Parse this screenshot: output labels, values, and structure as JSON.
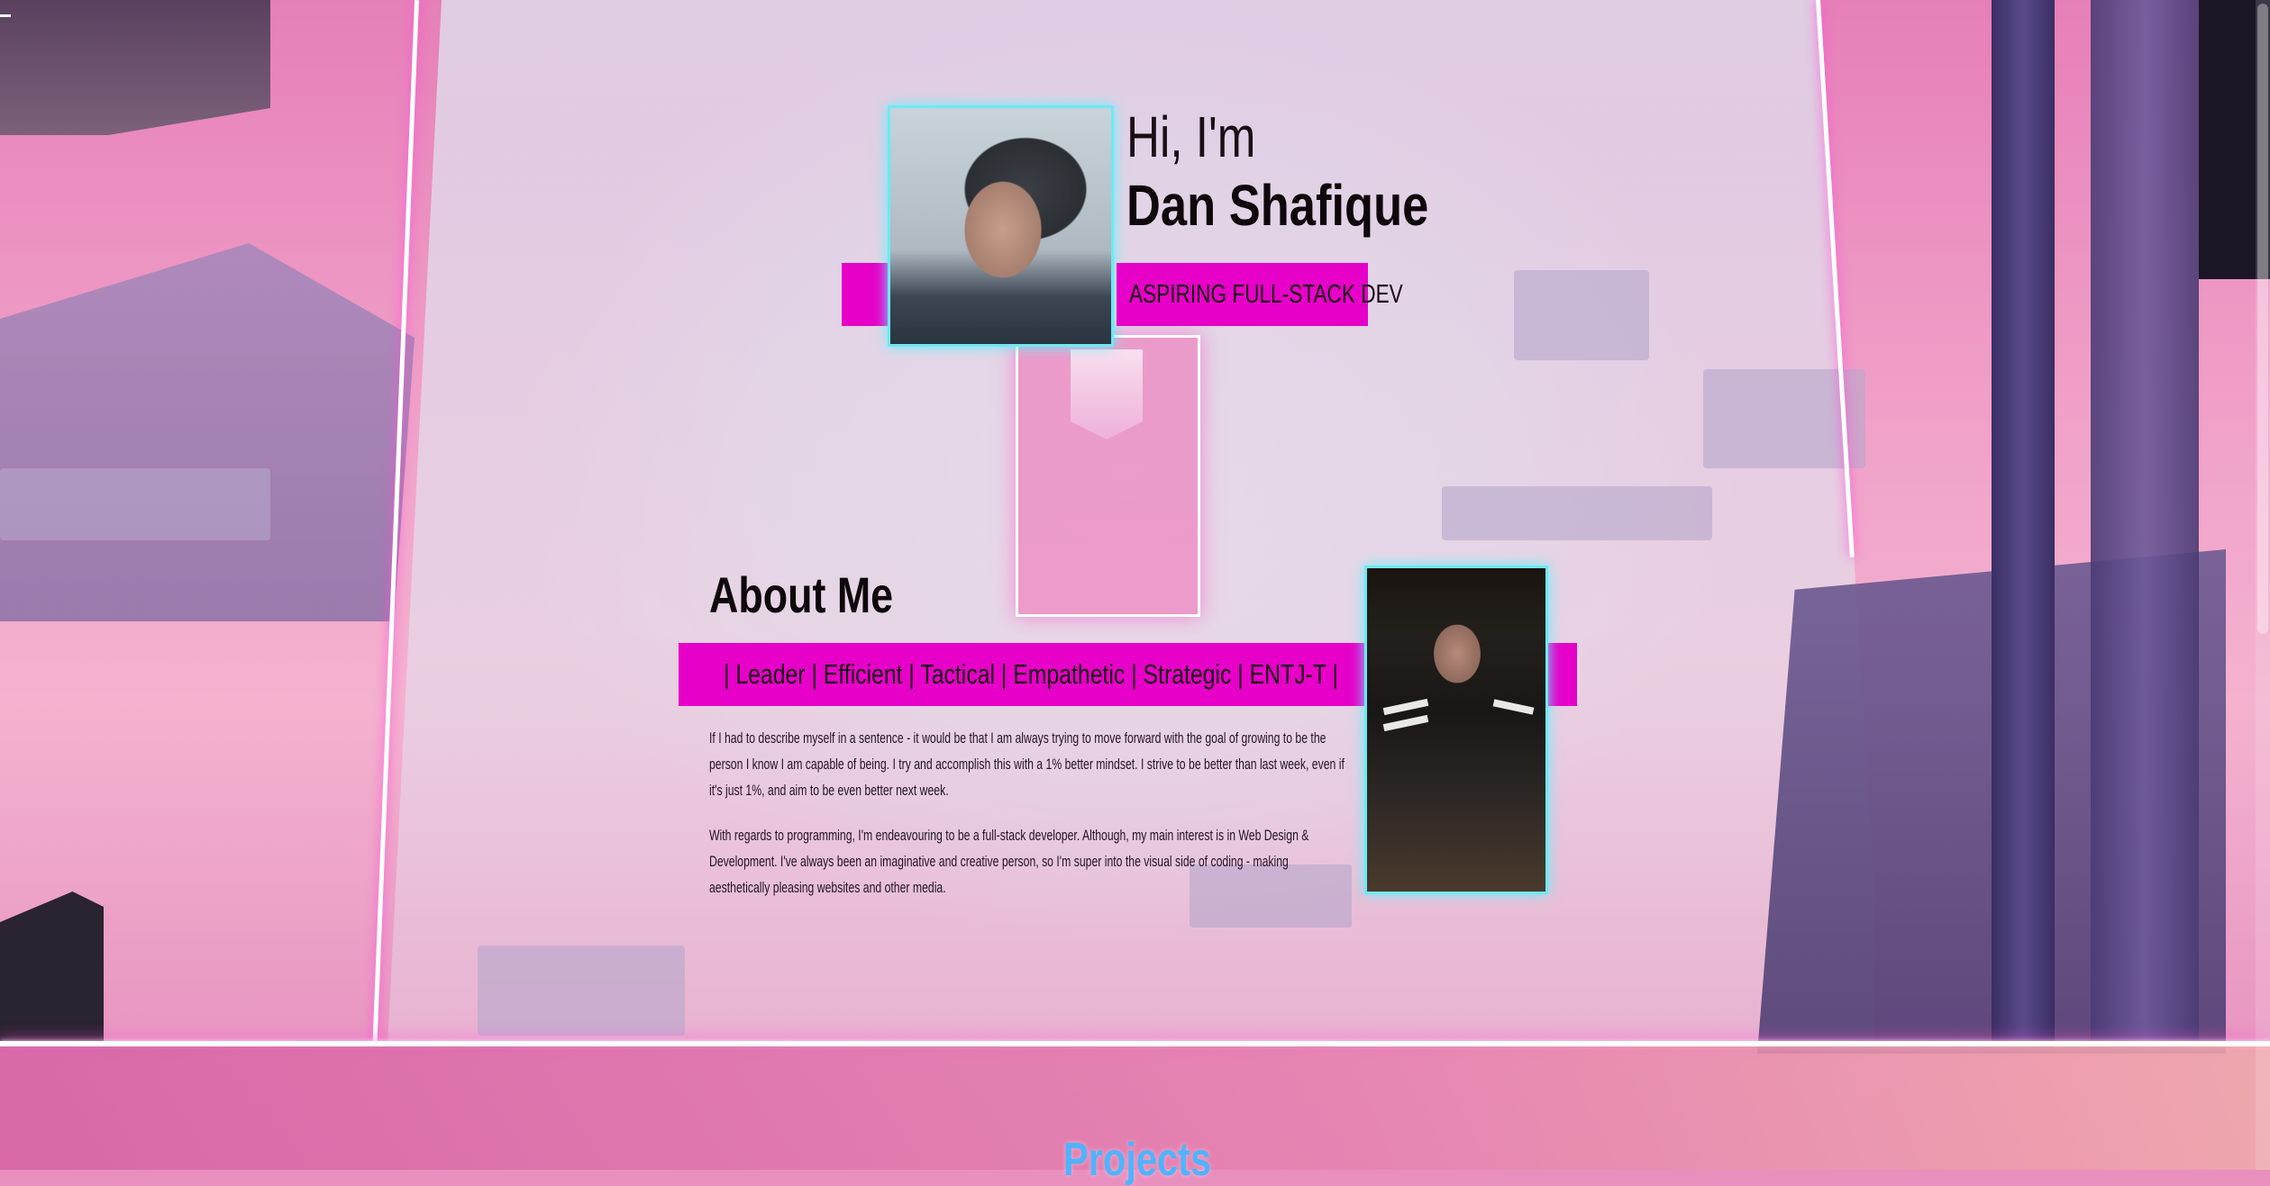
{
  "hero": {
    "greeting": "Hi, I'm",
    "name": "Dan Shafique",
    "role": "ASPIRING FULL-STACK DEV"
  },
  "about": {
    "title": "About Me",
    "traits": "| Leader | Efficient | Tactical | Empathetic | Strategic | ENTJ-T |",
    "paragraph_1": "If I had to describe myself in a sentence - it would be that I am always trying to move forward with the goal of growing to be the person I know I am capable of being. I try and accomplish this with a 1% better mindset. I strive to be better than last week, even if it's just 1%, and aim to be even better next week.",
    "paragraph_2": "With regards to programming, I'm endeavouring to be a full-stack developer. Although, my main interest is in Web Design & Development. I've always been an imaginative and creative person, so I'm super into the visual side of coding - making aesthetically pleasing websites and other media."
  },
  "projects": {
    "heading": "Projects"
  },
  "colors": {
    "accent_magenta": "#e600c8",
    "photo_border_cyan": "#6fe8f0",
    "projects_blue": "#4fb3ff"
  }
}
